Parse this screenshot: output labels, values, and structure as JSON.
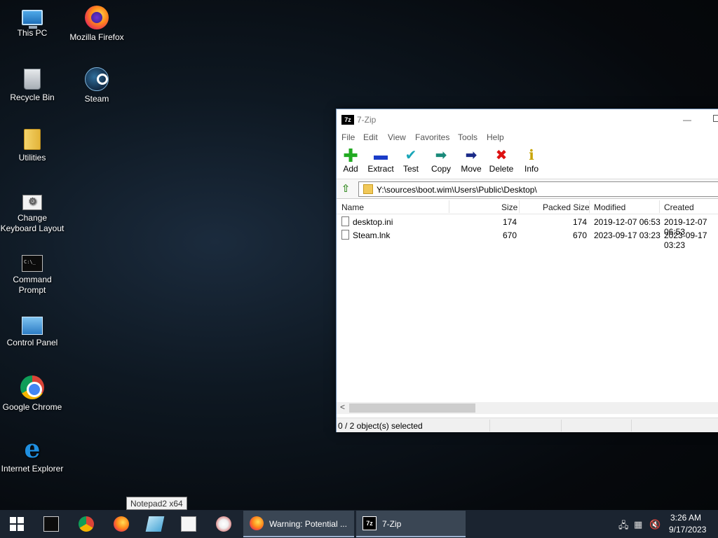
{
  "desktop": {
    "icons": [
      {
        "label": "This PC"
      },
      {
        "label": "Mozilla Firefox"
      },
      {
        "label": "Recycle Bin"
      },
      {
        "label": "Steam"
      },
      {
        "label": "Utilities"
      },
      {
        "label": "Change Keyboard Layout"
      },
      {
        "label": "Command Prompt"
      },
      {
        "label": "Control Panel"
      },
      {
        "label": "Google Chrome"
      },
      {
        "label": "Internet Explorer"
      }
    ]
  },
  "window": {
    "title": "7-Zip",
    "icon_text": "7z",
    "menu": [
      "File",
      "Edit",
      "View",
      "Favorites",
      "Tools",
      "Help"
    ],
    "toolbar": [
      "Add",
      "Extract",
      "Test",
      "Copy",
      "Move",
      "Delete",
      "Info"
    ],
    "address": "Y:\\sources\\boot.wim\\Users\\Public\\Desktop\\",
    "columns": [
      "Name",
      "Size",
      "Packed Size",
      "Modified",
      "Created"
    ],
    "files": [
      {
        "name": "desktop.ini",
        "size": "174",
        "packed": "174",
        "modified": "2019-12-07 06:53",
        "created": "2019-12-07 06:53"
      },
      {
        "name": "Steam.lnk",
        "size": "670",
        "packed": "670",
        "modified": "2023-09-17 03:23",
        "created": "2023-09-17 03:23"
      }
    ],
    "status": "0 / 2 object(s) selected"
  },
  "tooltip": "Notepad2 x64",
  "taskbar": {
    "buttons": [
      {
        "label": "Warning: Potential ..."
      },
      {
        "label": "7-Zip",
        "icon_text": "7z"
      }
    ],
    "clock_time": "3:26 AM",
    "clock_date": "9/17/2023"
  },
  "colors": {
    "taskbar": "#1b2430",
    "active_button": "#3a4654",
    "add": "#22aa22",
    "extract": "#1a3cc8",
    "test": "#1aa6b8",
    "copy": "#1a8a7a",
    "move": "#1a2a88",
    "delete": "#dd1111",
    "info": "#c8a400"
  }
}
